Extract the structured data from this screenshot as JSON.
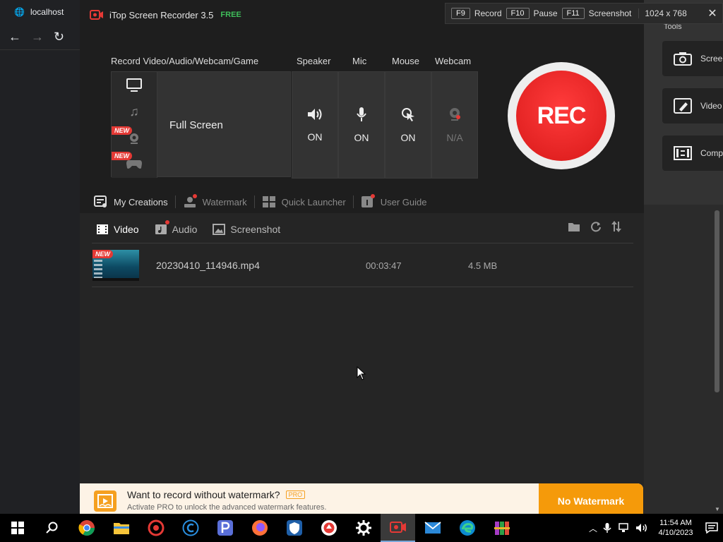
{
  "browser": {
    "tab_title": "localhost",
    "nav_back": "←",
    "nav_forward": "→",
    "nav_reload": "↻"
  },
  "app": {
    "title": "iTop Screen Recorder 3.5",
    "edition": "FREE",
    "hotkeys": [
      {
        "key": "F9",
        "label": "Record"
      },
      {
        "key": "F10",
        "label": "Pause"
      },
      {
        "key": "F11",
        "label": "Screenshot"
      }
    ],
    "resolution": "1024 x 768",
    "close_glyph": "✕"
  },
  "record": {
    "section_label": "Record Video/Audio/Webcam/Game",
    "new_tag": "NEW",
    "mode_value": "Full Screen",
    "toggles": [
      {
        "label": "Speaker",
        "status": "ON",
        "icon": "speaker-icon"
      },
      {
        "label": "Mic",
        "status": "ON",
        "icon": "mic-icon"
      },
      {
        "label": "Mouse",
        "status": "ON",
        "icon": "mouse-click-icon"
      },
      {
        "label": "Webcam",
        "status": "N/A",
        "icon": "webcam-icon"
      }
    ],
    "rec_label": "REC"
  },
  "bottom_tabs": [
    "My Creations",
    "Watermark",
    "Quick Launcher",
    "User Guide"
  ],
  "media_tabs": [
    "Video",
    "Audio",
    "Screenshot"
  ],
  "files": [
    {
      "new_tag": "NEW",
      "name": "20230410_114946.mp4",
      "duration": "00:03:47",
      "size": "4.5 MB"
    }
  ],
  "promo": {
    "title": "Want to record without watermark?",
    "badge": "PRO",
    "subtitle": "Activate PRO to unlock the advanced watermark features.",
    "button": "No Watermark"
  },
  "right_panel": {
    "title": "Tools",
    "cards": [
      "Screen",
      "Video",
      "Comp"
    ]
  },
  "taskbar": {
    "time": "11:54 AM",
    "date": "4/10/2023"
  },
  "colors": {
    "rec_red": "#e01f1f",
    "accent_orange": "#f59a0a",
    "free_green": "#3fbf5a",
    "new_red": "#e53935"
  }
}
